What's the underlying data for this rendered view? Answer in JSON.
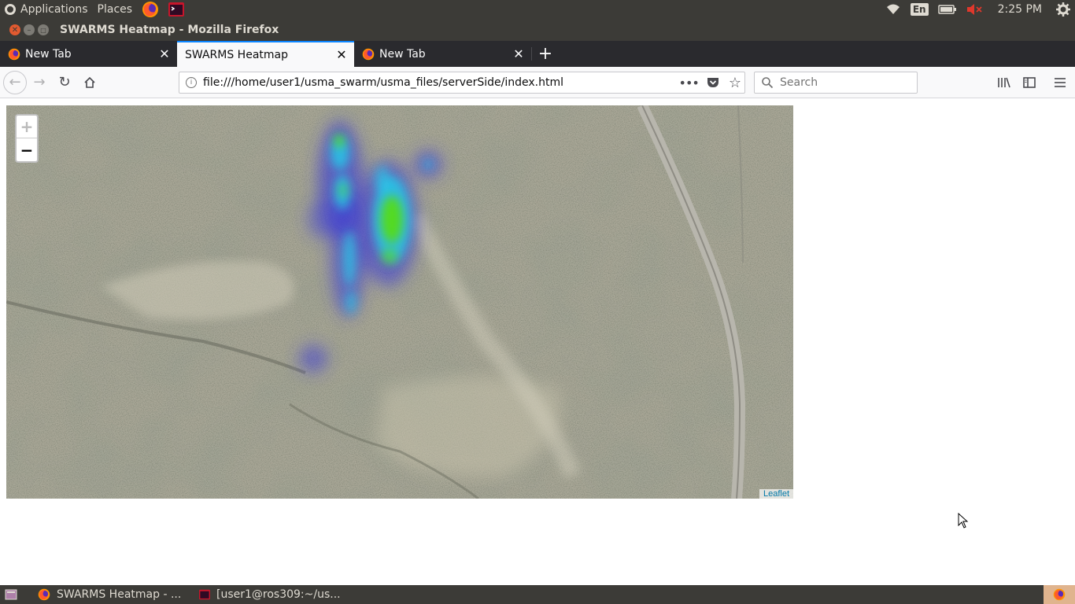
{
  "top_panel": {
    "applications_label": "Applications",
    "places_label": "Places",
    "keyboard_layout": "En",
    "clock": "2:25 PM"
  },
  "window": {
    "title": "SWARMS Heatmap - Mozilla Firefox"
  },
  "tabs": [
    {
      "label": "New Tab",
      "active": false
    },
    {
      "label": "SWARMS Heatmap",
      "active": true
    },
    {
      "label": "New Tab",
      "active": false
    }
  ],
  "toolbar": {
    "url": "file:///home/user1/usma_swarm/usma_files/serverSide/index.html",
    "search_placeholder": "Search"
  },
  "map": {
    "zoom_in_label": "+",
    "zoom_out_label": "−",
    "attribution": "Leaflet"
  },
  "taskbar": {
    "items": [
      {
        "label": "SWARMS Heatmap - ..."
      },
      {
        "label": "[user1@ros309:~/us..."
      }
    ]
  },
  "colors": {
    "panel": "#3c3b37",
    "tabstrip": "#2a2a2e",
    "tab_accent": "#0a84ff",
    "heat_low": "#3b3bd6",
    "heat_mid": "#27c8e8",
    "heat_high": "#5ae000"
  }
}
